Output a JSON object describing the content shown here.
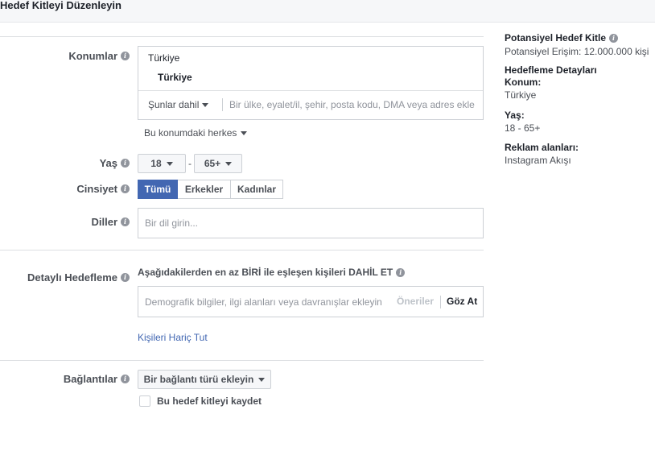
{
  "header": {
    "title": "Hedef Kitleyi Düzenleyin"
  },
  "locations": {
    "label": "Konumlar",
    "country": "Türkiye",
    "selected": "Türkiye",
    "include_dropdown": "Şunlar dahil",
    "input_placeholder": "Bir ülke, eyalet/il, şehir, posta kodu, DMA veya adres ekle",
    "audience_dropdown": "Bu konumdaki herkes"
  },
  "age": {
    "label": "Yaş",
    "min": "18",
    "separator": "-",
    "max": "65+"
  },
  "gender": {
    "label": "Cinsiyet",
    "options": [
      "Tümü",
      "Erkekler",
      "Kadınlar"
    ],
    "selected": "Tümü"
  },
  "languages": {
    "label": "Diller",
    "placeholder": "Bir dil girin..."
  },
  "detailed_targeting": {
    "label": "Detaylı Hedefleme",
    "description": "Aşağıdakilerden en az BİRİ ile eşleşen kişileri DAHİL ET",
    "placeholder": "Demografik bilgiler, ilgi alanları veya davranışlar ekleyin",
    "suggestions": "Öneriler",
    "browse": "Göz At",
    "exclude_link": "Kişileri Hariç Tut"
  },
  "connections": {
    "label": "Bağlantılar",
    "dropdown": "Bir bağlantı türü ekleyin",
    "save_checkbox": "Bu hedef kitleyi kaydet"
  },
  "summary": {
    "potential_title": "Potansiyel Hedef Kitle",
    "potential_reach": "Potansiyel Erişim: 12.000.000 kişi",
    "details_title": "Hedefleme Detayları",
    "location_label": "Konum:",
    "location_value": "Türkiye",
    "age_label": "Yaş:",
    "age_value": "18 - 65+",
    "placements_label": "Reklam alanları:",
    "placements_value": "Instagram Akışı"
  },
  "colors": {
    "accent": "#4267b2",
    "border": "#ccd0d5",
    "label": "#4b4f56"
  }
}
